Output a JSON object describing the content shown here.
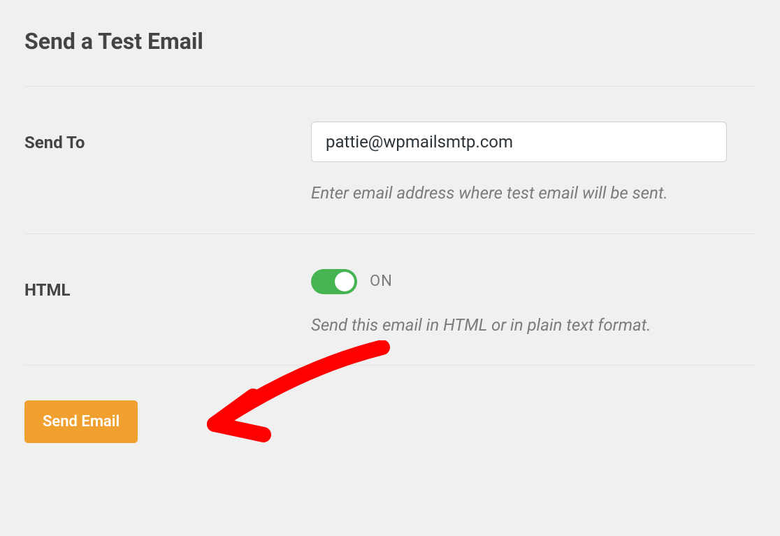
{
  "section": {
    "title": "Send a Test Email"
  },
  "sendTo": {
    "label": "Send To",
    "value": "pattie@wpmailsmtp.com",
    "help": "Enter email address where test email will be sent."
  },
  "htmlToggle": {
    "label": "HTML",
    "stateLabel": "ON",
    "help": "Send this email in HTML or in plain text format."
  },
  "submit": {
    "label": "Send Email"
  }
}
